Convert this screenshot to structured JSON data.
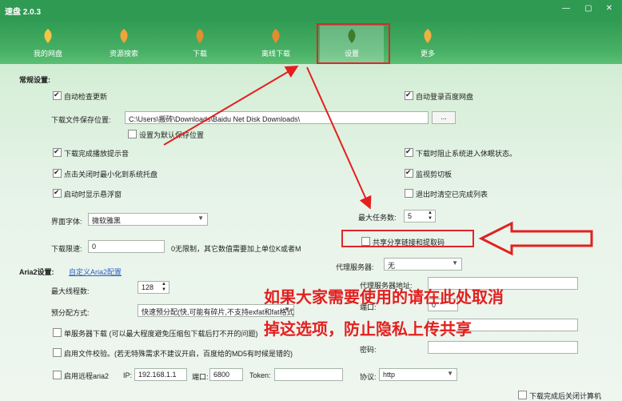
{
  "window": {
    "title": "速盘 2.0.3",
    "min_icon": "minimize-icon",
    "max_icon": "maximize-icon",
    "close_icon": "close-icon"
  },
  "nav": [
    {
      "label": "我的网盘",
      "icon": "leaf-icon"
    },
    {
      "label": "资源搜索",
      "icon": "leaf-icon"
    },
    {
      "label": "下载",
      "icon": "leaf-icon"
    },
    {
      "label": "离线下载",
      "icon": "leaf-icon"
    },
    {
      "label": "设置",
      "icon": "leaf-icon"
    },
    {
      "label": "更多",
      "icon": "leaf-icon"
    }
  ],
  "general": {
    "title": "常规设置:",
    "auto_update": "自动检查更新",
    "auto_login": "自动登录百度网盘",
    "save_path_label": "下载文件保存位置:",
    "save_path_value": "C:\\Users\\搬砖\\Downloads\\Baidu Net Disk Downloads\\",
    "browse": "...",
    "set_default": "设置为默认保存位置",
    "done_sound": "下载完成播放提示音",
    "prevent_sleep": "下载时阻止系统进入休眠状态。",
    "min_tray": "点击关闭时最小化到系统托盘",
    "monitor_clip": "监视剪切板",
    "show_float": "启动时显示悬浮窗",
    "clear_done": "退出时清空已完成列表",
    "font_label": "界面字体:",
    "font_value": "微软雅黑",
    "max_tasks_label": "最大任务数:",
    "max_tasks_value": "5",
    "share_label": "共享分享链接和提取码",
    "speed_label": "下载限速:",
    "speed_value": "0",
    "speed_hint": "0无限制，其它数值需要加上单位K或者M"
  },
  "aria": {
    "title": "Aria2设置:",
    "custom_link": "自定义Aria2配置",
    "proxy_label": "代理服务器:",
    "proxy_value": "无",
    "threads_label": "最大线程数:",
    "threads_value": "128",
    "prealloc_label": "预分配方式:",
    "prealloc_value": "快速预分配(快,可能有碎片,不支持exfat和fat格式)",
    "proxy_addr_label": "代理服务器地址:",
    "port_label": "端口:",
    "port_value": "0",
    "single_server": "单服务器下载 (可以最大程度避免压缩包下载后打不开的问题)",
    "file_verify": "启用文件校验。(若无特殊需求不建议开启，百度给的MD5有时候是错的)",
    "password_label": "密码:",
    "remote_aria": "启用远程aria2",
    "ip_label": "IP:",
    "ip_value": "192.168.1.1",
    "remote_port_label": "端口:",
    "remote_port_value": "6800",
    "token_label": "Token:",
    "protocol_label": "协议:",
    "protocol_value": "http",
    "shutdown": "下载完成后关闭计算机"
  },
  "annotation": {
    "line1": "如果大家需要使用的请在此处取消",
    "line2": "掉这选项，防止隐私上传共享"
  },
  "colors": {
    "accent": "#2f9a52",
    "annotation": "#e41f1f"
  }
}
